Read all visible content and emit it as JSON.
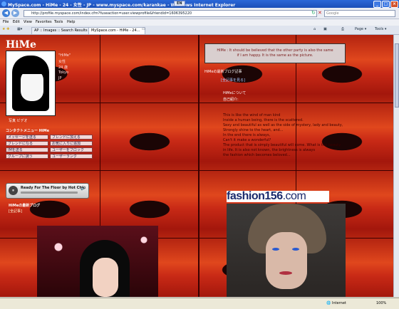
{
  "window": {
    "title": "MySpace.com - HiMe - 24 - 女性 - JP - www.myspace.com/karankae - Windows Internet Explorer",
    "lang_indicator": "EN",
    "min": "_",
    "max": "□",
    "close": "×"
  },
  "toolbar": {
    "back": "◀",
    "forward": "▶",
    "address": "http://profile.myspace.com/index.cfm?fuseaction=user.viewprofile&friendid=1606395220",
    "search_placeholder": "Google"
  },
  "menu": [
    "File",
    "Edit",
    "View",
    "Favorites",
    "Tools",
    "Help"
  ],
  "tabs": [
    {
      "label": "AP :: Images :: Search Results"
    },
    {
      "label": "MySpace.com - HiMe - 24..."
    }
  ],
  "command_bar": {
    "home": "⌂",
    "feeds": "▣",
    "print": "⎙",
    "page": "Page ▾",
    "tools": "Tools ▾"
  },
  "profile": {
    "name": "HiMe",
    "photo_links": "写真   ビデオ",
    "contact_title": "コンタクトメニュー HiMe",
    "contact_buttons": [
      "メッセージを送る",
      "フレンドに加える",
      "フレンドになる",
      "お気に入りに追加",
      "IMを送る",
      "ユーザーをブロック",
      "グループに誘う",
      "ユーザーランク"
    ]
  },
  "player": {
    "play_icon": "⏸",
    "track": "Ready For The Floor by Hot Chip",
    "volume_icon": "🔊"
  },
  "blog": {
    "title": "HiMeの最新ブログ",
    "link": "[全記事]"
  },
  "right": {
    "quote_line1": "HiMe : It should be believed that the other party is also the same",
    "quote_line2": "if I am happy. It is the same as the picture.",
    "latest_blog": "HiMeの最新ブログ記事",
    "latest_link": "[全記事を見る]",
    "about_head": "HiMeについて",
    "about_sub": "自己紹介:",
    "about_lines": [
      "This is like the wind of man kind",
      "Inside a human being, there is the scattered.",
      "Sexy and beautiful as well as the side of mystery, lady and beauty,",
      "Strongly shine to the heart, and...",
      "In the end there is always,",
      "Can't it make a wonderful?",
      "The product that is simply beautiful will come. What is the beauty",
      "in life. It is also not known, the brightness is always",
      "the fashion which becomes beloved..."
    ],
    "fashion_logo": "fashion156",
    "fashion_logo_com": ".com"
  },
  "status": {
    "text": "Internet",
    "zoom": "100%"
  }
}
